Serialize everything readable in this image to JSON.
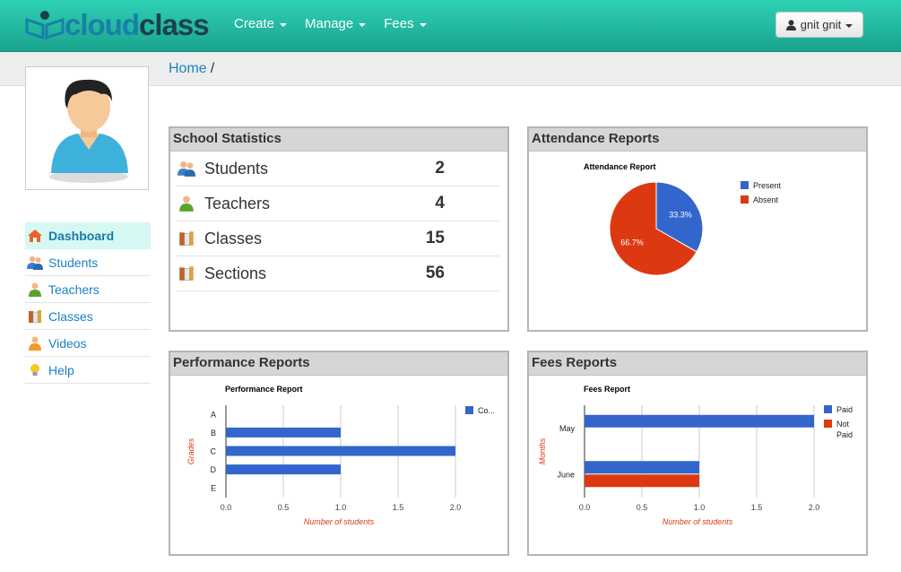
{
  "app": {
    "logo_cloud": "cloud",
    "logo_class": "class"
  },
  "nav": {
    "items": [
      {
        "label": "Create"
      },
      {
        "label": "Manage"
      },
      {
        "label": "Fees"
      }
    ],
    "user_label": "gnit gnit"
  },
  "breadcrumb": {
    "home": "Home",
    "separator": "/"
  },
  "sidebar": {
    "items": [
      {
        "label": "Dashboard",
        "icon": "home-icon",
        "active": true
      },
      {
        "label": "Students",
        "icon": "users-icon"
      },
      {
        "label": "Teachers",
        "icon": "teacher-icon"
      },
      {
        "label": "Classes",
        "icon": "books-icon"
      },
      {
        "label": "Videos",
        "icon": "video-user-icon"
      },
      {
        "label": "Help",
        "icon": "lightbulb-icon"
      }
    ]
  },
  "school_statistics": {
    "title": "School Statistics",
    "rows": [
      {
        "label": "Students",
        "value": "2",
        "icon": "users-icon"
      },
      {
        "label": "Teachers",
        "value": "4",
        "icon": "teacher-icon"
      },
      {
        "label": "Classes",
        "value": "15",
        "icon": "books-icon"
      },
      {
        "label": "Sections",
        "value": "56",
        "icon": "books-icon"
      }
    ]
  },
  "panels": {
    "attendance": "Attendance Reports",
    "performance": "Performance Reports",
    "fees": "Fees Reports"
  },
  "colors": {
    "blue": "#3366cc",
    "red": "#dc3912",
    "accent": "#1aa38f",
    "link": "#1a82c4"
  },
  "chart_data": [
    {
      "type": "pie",
      "title": "Attendance Report",
      "slices": [
        {
          "name": "Present",
          "value": 33.3,
          "label": "33.3%",
          "color": "#3366cc"
        },
        {
          "name": "Absent",
          "value": 66.7,
          "label": "66.7%",
          "color": "#dc3912"
        }
      ],
      "legend": "right"
    },
    {
      "type": "bar",
      "orientation": "horizontal",
      "title": "Performance Report",
      "categories": [
        "A",
        "B",
        "C",
        "D",
        "E"
      ],
      "series": [
        {
          "name": "Co...",
          "values": [
            0,
            1,
            2,
            1,
            0
          ],
          "color": "#3366cc"
        }
      ],
      "xlabel": "Number of students",
      "ylabel": "Grades",
      "xlim": [
        0,
        2
      ],
      "xticks": [
        "0.0",
        "0.5",
        "1.0",
        "1.5",
        "2.0"
      ],
      "legend": "right"
    },
    {
      "type": "bar",
      "orientation": "horizontal",
      "title": "Fees Report",
      "categories": [
        "May",
        "June"
      ],
      "series": [
        {
          "name": "Paid",
          "values": [
            2,
            1
          ],
          "color": "#3366cc"
        },
        {
          "name": "Not Paid",
          "values": [
            0,
            1
          ],
          "color": "#dc3912"
        }
      ],
      "xlabel": "Number of students",
      "ylabel": "Months",
      "xlim": [
        0,
        2
      ],
      "xticks": [
        "0.0",
        "0.5",
        "1.0",
        "1.5",
        "2.0"
      ],
      "legend": "right"
    }
  ]
}
